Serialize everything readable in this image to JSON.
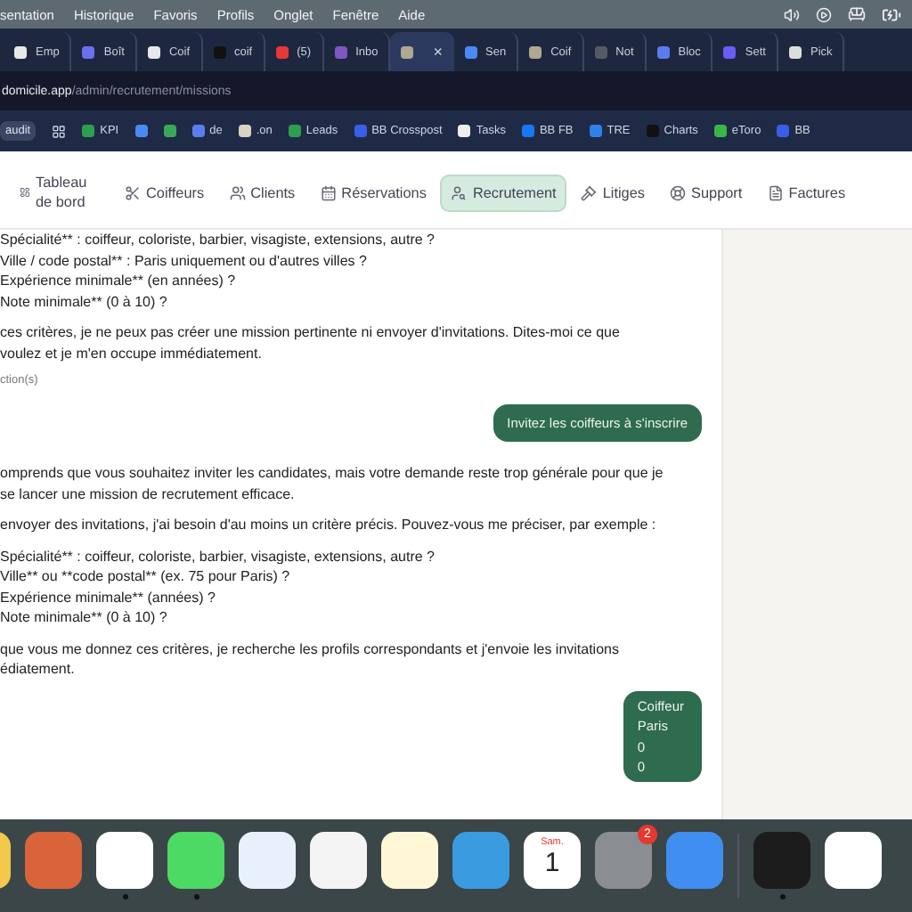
{
  "menubar": {
    "items": [
      "sentation",
      "Historique",
      "Favoris",
      "Profils",
      "Onglet",
      "Fenêtre",
      "Aide"
    ]
  },
  "tabs": [
    {
      "label": "Emp",
      "color": "#e8e8e8",
      "selected": false
    },
    {
      "label": "Boît",
      "color": "#6b6ff0",
      "selected": false
    },
    {
      "label": "Coif",
      "color": "#e8e8e8",
      "selected": false
    },
    {
      "label": "coif",
      "color": "#111111",
      "selected": false
    },
    {
      "label": "(5)",
      "color": "#e53935",
      "selected": false
    },
    {
      "label": "Inbo",
      "color": "#7e57c2",
      "selected": false
    },
    {
      "color": "#b0a890",
      "selected": true,
      "close": "×"
    },
    {
      "label": "Sen",
      "color": "#4a8af4",
      "selected": false
    },
    {
      "label": "Coif",
      "color": "#b0a890",
      "selected": false
    },
    {
      "label": "Not",
      "color": "#555b66",
      "selected": false
    },
    {
      "label": "Bloc",
      "color": "#5b7cf0",
      "selected": false
    },
    {
      "label": "Sett",
      "color": "#6a5cf5",
      "selected": false
    },
    {
      "label": "Pick",
      "color": "#dddddd",
      "selected": false
    }
  ],
  "address": {
    "domain": "domicile.app",
    "path": "/admin/recrutement/missions"
  },
  "bookmarks": [
    {
      "label": "audit",
      "kind": "pill"
    },
    {
      "kind": "grid"
    },
    {
      "label": "KPI",
      "kind": "icon",
      "color": "#2e9e4f"
    },
    {
      "kind": "icon",
      "color": "#4a8af4"
    },
    {
      "kind": "icon",
      "color": "#3aa757"
    },
    {
      "label": "de",
      "kind": "icon",
      "color": "#5b7cf0"
    },
    {
      "label": ".on",
      "kind": "icon",
      "color": "#d9d2c5"
    },
    {
      "label": "Leads",
      "kind": "icon",
      "color": "#2e9e4f"
    },
    {
      "label": "BB Crosspost",
      "kind": "icon",
      "color": "#3b5ee8"
    },
    {
      "label": "Tasks",
      "kind": "icon",
      "color": "#eeeeee"
    },
    {
      "label": "BB FB",
      "kind": "icon",
      "color": "#1877f2"
    },
    {
      "label": "TRE",
      "kind": "icon",
      "color": "#2f80ed"
    },
    {
      "label": "Charts",
      "kind": "icon",
      "color": "#111111"
    },
    {
      "label": "eToro",
      "kind": "icon",
      "color": "#3bb54a"
    },
    {
      "label": "BB",
      "kind": "icon",
      "color": "#3b5ee8"
    }
  ],
  "nav": [
    {
      "label": "Tableau de bord",
      "selected": false
    },
    {
      "label": "Coiffeurs",
      "selected": false
    },
    {
      "label": "Clients",
      "selected": false
    },
    {
      "label": "Réservations",
      "selected": false
    },
    {
      "label": "Recrutement",
      "selected": true
    },
    {
      "label": "Litiges",
      "selected": false
    },
    {
      "label": "Support",
      "selected": false
    },
    {
      "label": "Factures",
      "selected": false
    }
  ],
  "messages": [
    {
      "kind": "reply",
      "paragraphs": [
        [
          "Spécialité** : coiffeur, coloriste, barbier, visagiste, extensions, autre ?",
          "Ville / code postal** : Paris uniquement ou d'autres villes ?",
          "Expérience minimale** (en années) ?",
          "Note minimale** (0 à 10) ?"
        ],
        [
          "ces critères, je ne peux pas créer une mission pertinente ni envoyer d'invitations. Dites-moi ce que",
          "voulez et je m'en occupe immédiatement."
        ]
      ],
      "caption": "ction(s)"
    },
    {
      "kind": "prompt",
      "lines": [
        "Invitez les coiffeurs à s'inscrire"
      ]
    },
    {
      "kind": "reply",
      "paragraphs": [
        [
          "omprends que vous souhaitez inviter les candidates, mais votre demande reste trop générale pour que je",
          "se lancer une mission de recrutement efficace."
        ],
        [
          "envoyer des invitations, j'ai besoin d'au moins un critère précis. Pouvez-vous me préciser, par exemple :"
        ],
        [
          "Spécialité** : coiffeur, coloriste, barbier, visagiste, extensions, autre ?",
          "Ville** ou **code postal** (ex. 75 pour Paris) ?",
          "Expérience minimale** (années) ?",
          "Note minimale** (0 à 10) ?"
        ],
        [
          "que vous me donnez ces critères, je recherche les profils correspondants et j'envoie les invitations",
          "édiatement."
        ]
      ]
    },
    {
      "kind": "prompt",
      "lines": [
        "Coiffeur",
        "Paris",
        "0",
        "0"
      ]
    }
  ],
  "dock": [
    {
      "kind": "app",
      "color": "#f2c94c",
      "running": false
    },
    {
      "kind": "app",
      "color": "#d9643a",
      "running": false
    },
    {
      "kind": "app",
      "color": "#ffffff",
      "running": true
    },
    {
      "kind": "app",
      "color": "#4cd964",
      "running": true
    },
    {
      "kind": "app",
      "color": "#e8f1fb",
      "running": false
    },
    {
      "kind": "app",
      "color": "#f4f4f4",
      "running": false
    },
    {
      "kind": "app",
      "color": "#fff7d6",
      "running": false
    },
    {
      "kind": "app",
      "color": "#3a9be0",
      "running": false
    },
    {
      "kind": "calendar",
      "day": "Sam.",
      "date": "1",
      "running": false
    },
    {
      "kind": "app",
      "color": "#8a8d92",
      "badge": "2",
      "running": false
    },
    {
      "kind": "app",
      "color": "#3f8ef0",
      "running": false
    },
    {
      "kind": "separator"
    },
    {
      "kind": "app",
      "color": "#1c1c1c",
      "running": true
    },
    {
      "kind": "app",
      "color": "#ffffff",
      "running": false
    }
  ]
}
